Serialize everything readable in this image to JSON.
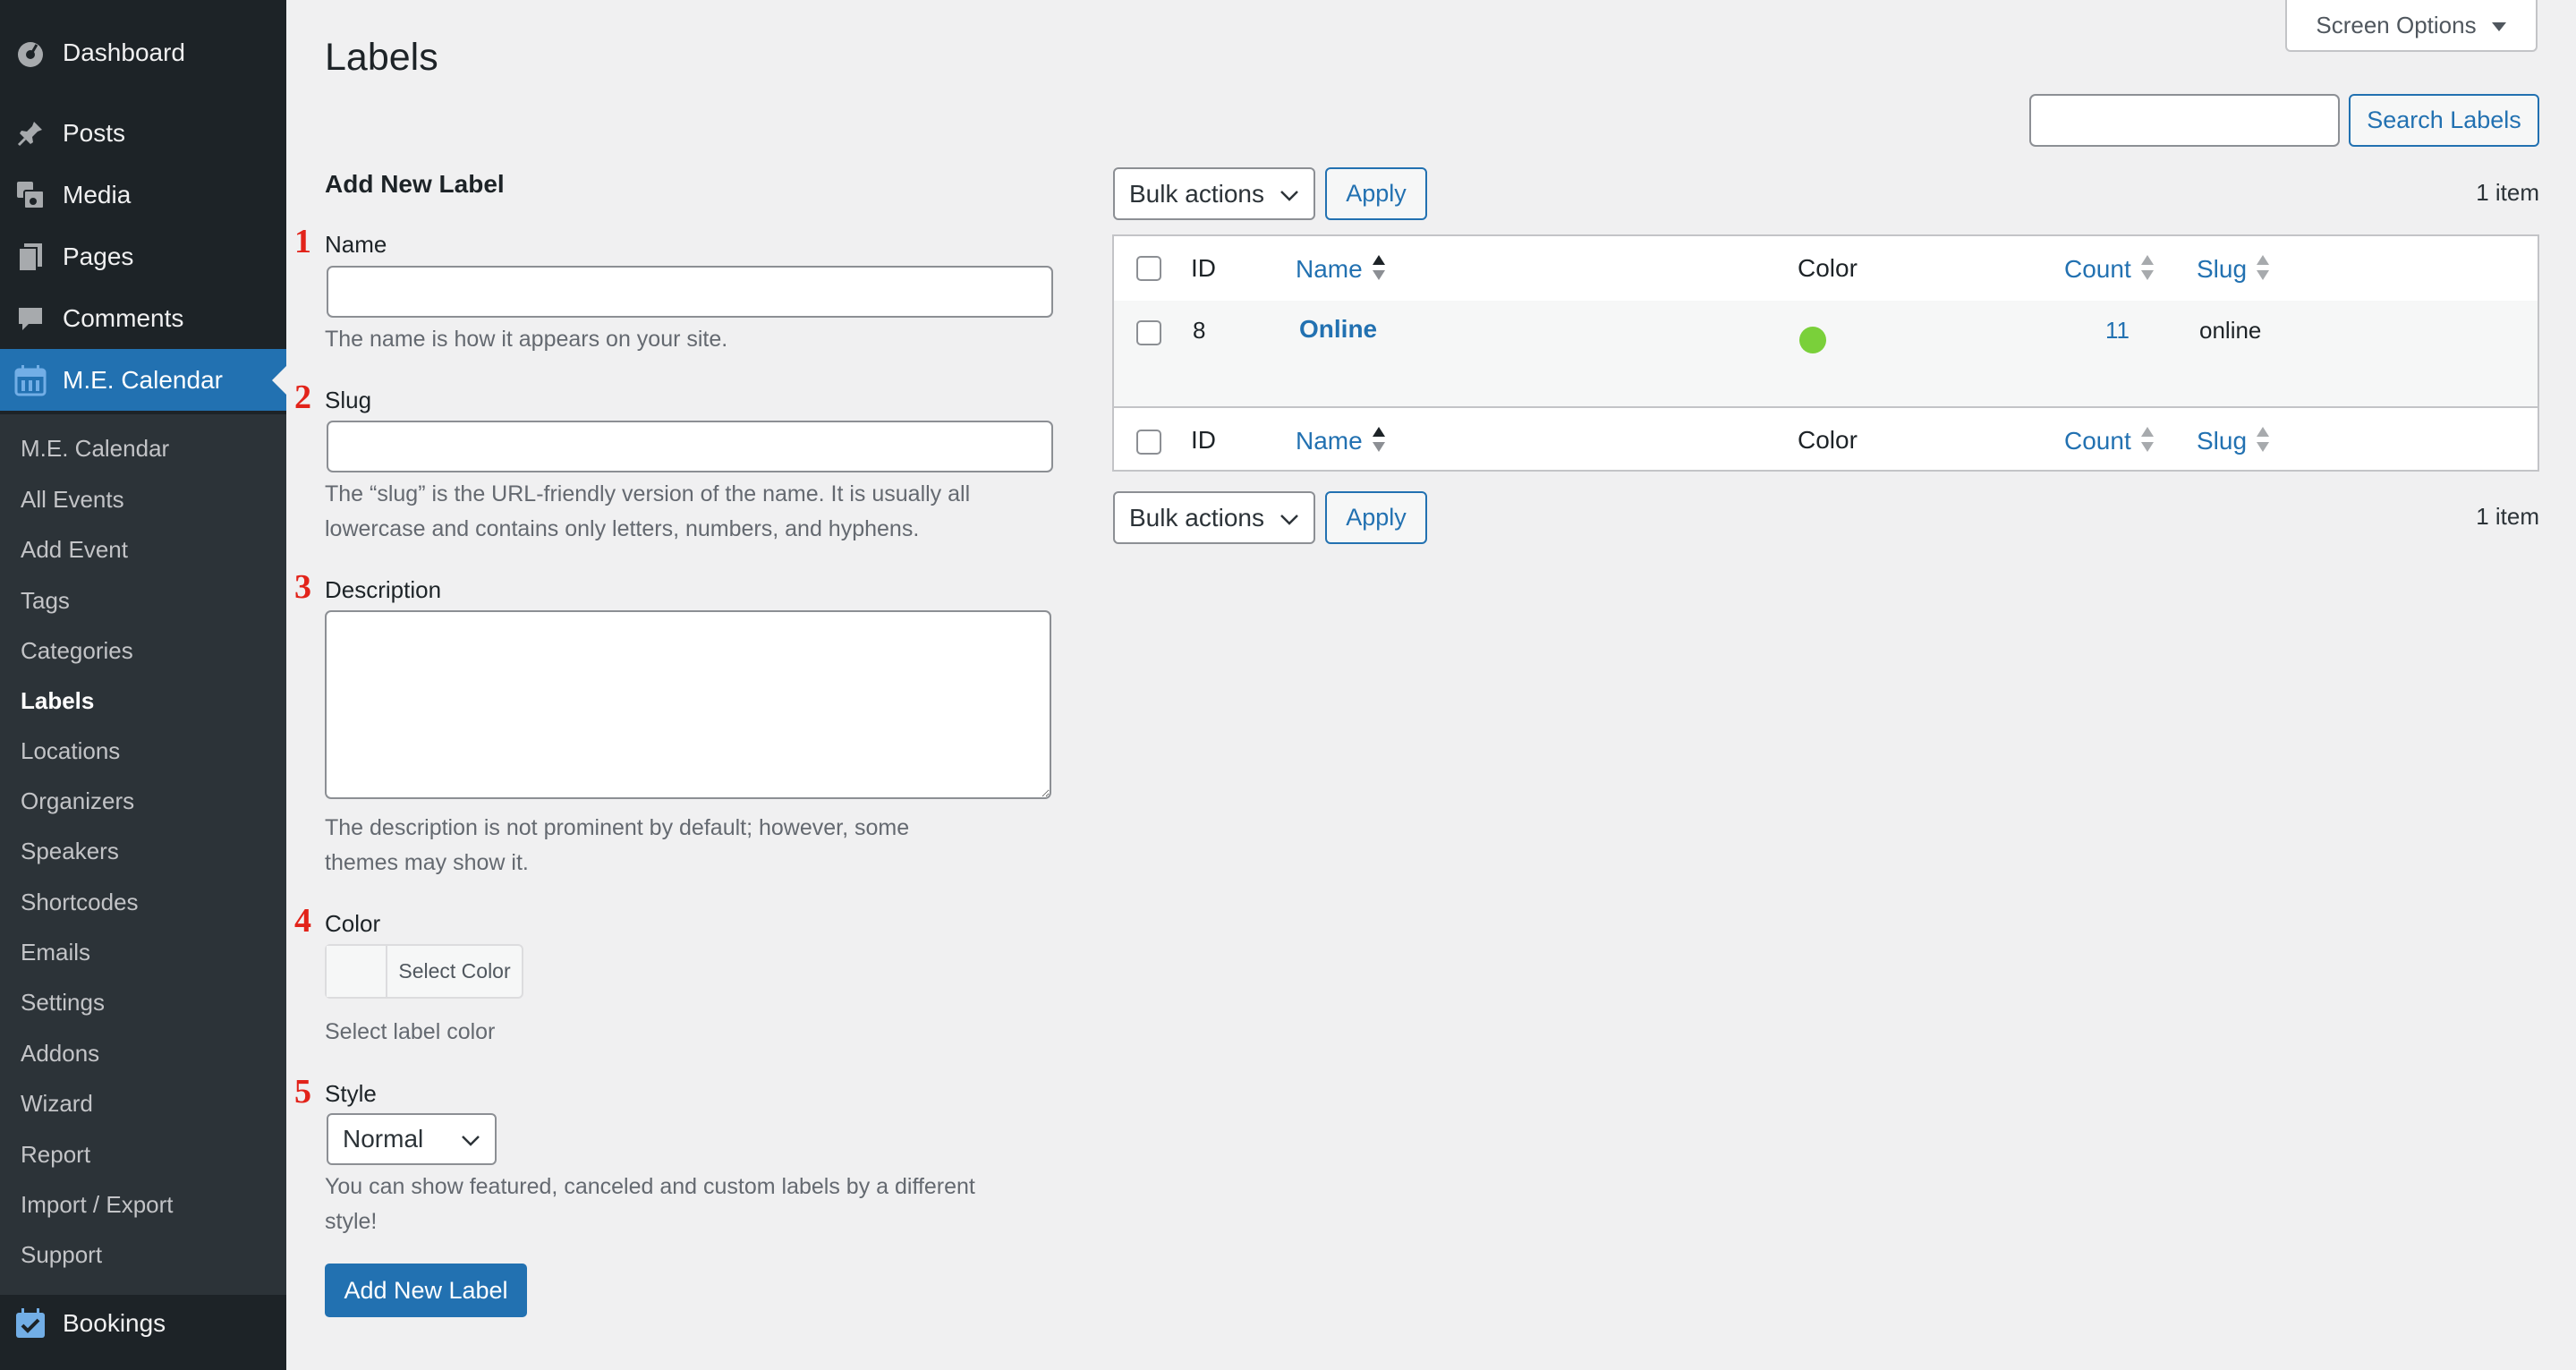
{
  "sidebar": {
    "top_items": [
      {
        "label": "Dashboard"
      },
      {
        "label": "Posts"
      },
      {
        "label": "Media"
      },
      {
        "label": "Pages"
      },
      {
        "label": "Comments"
      },
      {
        "label": "M.E. Calendar"
      }
    ],
    "sub_items": [
      {
        "label": "M.E. Calendar"
      },
      {
        "label": "All Events"
      },
      {
        "label": "Add Event"
      },
      {
        "label": "Tags"
      },
      {
        "label": "Categories"
      },
      {
        "label": "Labels"
      },
      {
        "label": "Locations"
      },
      {
        "label": "Organizers"
      },
      {
        "label": "Speakers"
      },
      {
        "label": "Shortcodes"
      },
      {
        "label": "Emails"
      },
      {
        "label": "Settings"
      },
      {
        "label": "Addons"
      },
      {
        "label": "Wizard"
      },
      {
        "label": "Report"
      },
      {
        "label": "Import / Export"
      },
      {
        "label": "Support"
      }
    ],
    "bottom_item": {
      "label": "Bookings"
    },
    "colors": {
      "bg": "#1d2327",
      "submenu_bg": "#2c3338",
      "active": "#2271b1"
    }
  },
  "header": {
    "title": "Labels",
    "screen_options": "Screen Options",
    "search_button": "Search Labels",
    "search_value": ""
  },
  "form": {
    "heading": "Add New Label",
    "steps": [
      "1",
      "2",
      "3",
      "4",
      "5"
    ],
    "name_label": "Name",
    "name_value": "",
    "name_help": "The name is how it appears on your site.",
    "slug_label": "Slug",
    "slug_value": "",
    "slug_help_1": "The “slug” is the URL-friendly version of the name. It is usually all",
    "slug_help_2": "lowercase and contains only letters, numbers, and hyphens.",
    "description_label": "Description",
    "description_value": "",
    "description_help_1": "The description is not prominent by default; however, some",
    "description_help_2": "themes may show it.",
    "color_label": "Color",
    "color_button": "Select Color",
    "color_help": "Select label color",
    "style_label": "Style",
    "style_value": "Normal",
    "style_help_1": "You can show featured, canceled and custom labels by a different",
    "style_help_2": "style!",
    "submit": "Add New Label"
  },
  "table": {
    "bulk_actions": "Bulk actions",
    "apply": "Apply",
    "items_count": "1 item",
    "columns": {
      "id": "ID",
      "name": "Name",
      "color": "Color",
      "count": "Count",
      "slug": "Slug"
    },
    "rows": [
      {
        "id": "8",
        "name": "Online",
        "color": "#7ad03a",
        "count": "11",
        "slug": "online"
      }
    ]
  }
}
